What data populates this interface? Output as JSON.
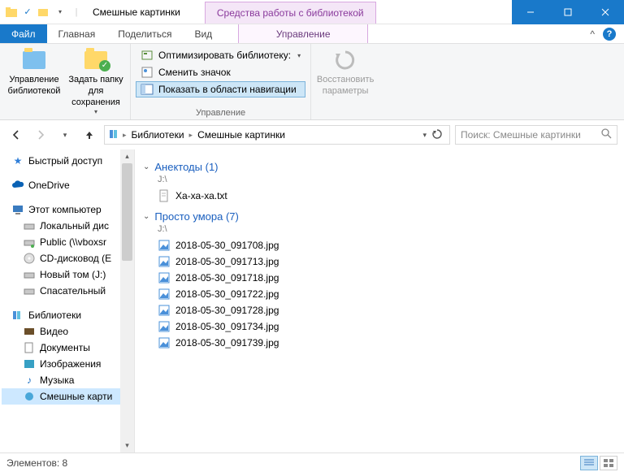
{
  "window": {
    "title": "Смешные картинки",
    "contextual_tab_header": "Средства работы с библиотекой"
  },
  "tabs": {
    "file": "Файл",
    "home": "Главная",
    "share": "Поделиться",
    "view": "Вид",
    "manage": "Управление"
  },
  "ribbon": {
    "group1": {
      "manage_library": "Управление библиотекой",
      "set_save_folder": "Задать папку для сохранения"
    },
    "group2": {
      "optimize": "Оптимизировать библиотеку:",
      "change_icon": "Сменить значок",
      "show_in_nav": "Показать в области навигации",
      "label": "Управление"
    },
    "group3": {
      "restore": "Восстановить параметры"
    }
  },
  "breadcrumb": {
    "root": "Библиотеки",
    "current": "Смешные картинки"
  },
  "search": {
    "placeholder": "Поиск: Смешные картинки"
  },
  "tree": {
    "quick_access": "Быстрый доступ",
    "onedrive": "OneDrive",
    "this_pc": "Этот компьютер",
    "local_disk": "Локальный дис",
    "public": "Public (\\\\vboxsr",
    "cd": "CD-дисковод (E",
    "new_vol": "Новый том (J:)",
    "recovery": "Спасательный",
    "libraries": "Библиотеки",
    "videos": "Видео",
    "documents": "Документы",
    "pictures": "Изображения",
    "music": "Музыка",
    "funny": "Смешные карти"
  },
  "groups": [
    {
      "title": "Анектоды",
      "count": "(1)",
      "sub": "J:\\",
      "items": [
        {
          "name": "Ха-ха-ха.txt",
          "kind": "txt"
        }
      ]
    },
    {
      "title": "Просто умора",
      "count": "(7)",
      "sub": "J:\\",
      "items": [
        {
          "name": "2018-05-30_091708.jpg",
          "kind": "img"
        },
        {
          "name": "2018-05-30_091713.jpg",
          "kind": "img"
        },
        {
          "name": "2018-05-30_091718.jpg",
          "kind": "img"
        },
        {
          "name": "2018-05-30_091722.jpg",
          "kind": "img"
        },
        {
          "name": "2018-05-30_091728.jpg",
          "kind": "img"
        },
        {
          "name": "2018-05-30_091734.jpg",
          "kind": "img"
        },
        {
          "name": "2018-05-30_091739.jpg",
          "kind": "img"
        }
      ]
    }
  ],
  "status": {
    "items_label": "Элементов:",
    "count": "8"
  }
}
